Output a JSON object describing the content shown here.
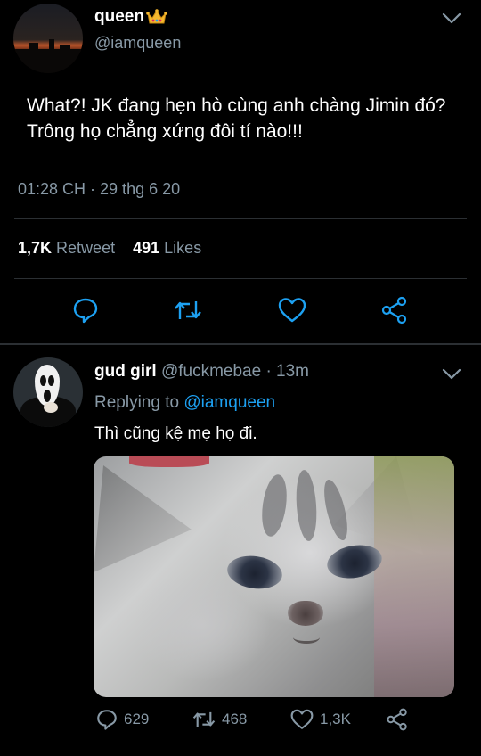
{
  "main_tweet": {
    "display_name": "queen",
    "handle": "@iamqueen",
    "text": "What?! JK đang hẹn hò cùng anh chàng Jimin đó? Trông họ chẳng xứng đôi tí nào!!!",
    "timestamp": "01:28 CH · 29 thg 6 20",
    "retweet_count": "1,7K",
    "retweet_label": "Retweet",
    "like_count": "491",
    "like_label": "Likes",
    "icons": [
      "reply-icon",
      "retweet-icon",
      "heart-icon",
      "share-icon",
      "chevron-down-icon",
      "crown-emoji"
    ]
  },
  "reply_tweet": {
    "display_name": "gud girl",
    "handle_time": "@fuckmebae · 13m",
    "replying_prefix": "Replying to",
    "replying_handle": "@iamqueen",
    "text": "Thì cũng kệ mẹ họ đi.",
    "reply_count": "629",
    "retweet_count": "468",
    "like_count": "1,3K"
  },
  "colors": {
    "background": "#000000",
    "secondary_text": "#8899a6",
    "link": "#1da1f2",
    "divider": "#2b2f33"
  }
}
